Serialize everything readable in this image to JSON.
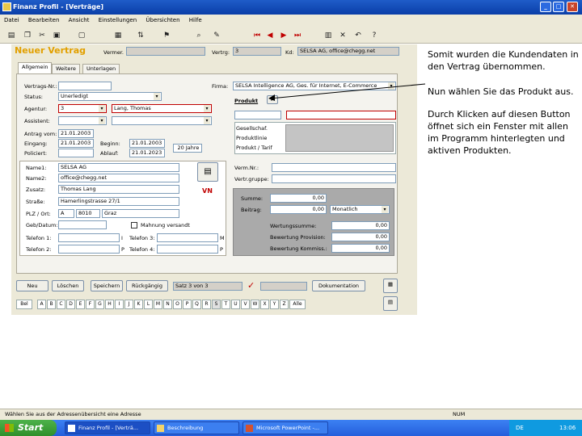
{
  "window": {
    "title": "Finanz Profil - [Verträge]",
    "controls": [
      "_",
      "□",
      "✕"
    ]
  },
  "menu": [
    "Datei",
    "Bearbeiten",
    "Ansicht",
    "Einstellungen",
    "Übersichten",
    "Hilfe"
  ],
  "toolbar_icons": [
    "printer-icon",
    "copy-icon",
    "cut-icon",
    "paste-icon",
    "document-icon",
    "grid-icon",
    "sort-icon",
    "filter-icon",
    "find-icon",
    "record-icon",
    "first-icon",
    "prev-icon",
    "next-icon",
    "last-icon",
    "help-icon"
  ],
  "form": {
    "heading": "Neuer Vertrag",
    "top": {
      "vermerk_label": "Vermer.",
      "vermerk_value": "",
      "vertrag_label": "Vertrg:",
      "vertrag_value": "3",
      "kd_label": "Kd:",
      "kd_value": "SELSA AG, office@chegg.net"
    },
    "tabs": [
      "Allgemein",
      "Weitere",
      "Unterlagen"
    ],
    "fields_left": [
      {
        "label": "Vertrags-Nr.:",
        "value": ""
      },
      {
        "label": "Status:",
        "value": "Unerledigt"
      },
      {
        "label": "Agentur:",
        "value": "3"
      },
      {
        "label": "Assistent:",
        "value": ""
      }
    ],
    "agent_name": "Lang, Thomas",
    "dates": [
      {
        "label": "Antrag vom:",
        "value": "21.01.2003"
      },
      {
        "label": "Eingang:",
        "value": "21.01.2003"
      },
      {
        "label": "Policiert:",
        "value": ""
      }
    ],
    "beginn_label": "Beginn:",
    "beginn_value": "21.01.2003",
    "ablauf_label": "Ablauf:",
    "ablauf_value": "21.01.2023",
    "laufzeit": "20 Jahre",
    "firma_label": "Firma:",
    "firma_value": "SELSA Intelligence AG, Ges. für Internet, E-Commerce",
    "produkt_label": "Produkt",
    "gray_lines": [
      "Gesellschaf.",
      "Produktlinie",
      "Produkt / Tarif"
    ],
    "customer": [
      {
        "label": "Name1:",
        "value": "SELSA AG"
      },
      {
        "label": "Name2:",
        "value": "office@chegg.net"
      },
      {
        "label": "Zusatz:",
        "value": "Thomas Lang"
      },
      {
        "label": "Straße:",
        "value": "Hamerlingstrasse 27/1"
      },
      {
        "label": "PLZ / Ort:",
        "value": "A",
        "value2": "8010",
        "value3": "Graz"
      },
      {
        "label": "Geb/Datum:",
        "value": ""
      }
    ],
    "kind_label": "VN",
    "verm_label": "Verm.Nr.:",
    "vertrgruppe_label": "Vertr.gruppe:",
    "mahnung_label": "Mahnung versandt",
    "phones": [
      {
        "label": "Telefon 1:",
        "value": "",
        "suffix": "I"
      },
      {
        "label": "Telefon 2:",
        "value": "",
        "suffix": "P"
      }
    ],
    "phones_right": [
      {
        "label": "Telefon 3:",
        "value": "",
        "suffix": "M"
      },
      {
        "label": "Telefon 4:",
        "value": "",
        "suffix": "P"
      }
    ],
    "money": [
      {
        "label": "Summe:",
        "value": "0,00"
      },
      {
        "label": "Beitrag:",
        "value": "0,00",
        "select": "Monatlich"
      }
    ],
    "bewertung": [
      {
        "label": "Wertungssumme:",
        "value": "0,00"
      },
      {
        "label": "Bewertung Provision:",
        "value": "0,00"
      },
      {
        "label": "Bewertung Kommiss.:",
        "value": "0,00"
      }
    ],
    "buttons": [
      "Neu",
      "Löschen",
      "Speichern",
      "Rückgängig"
    ],
    "satz_label": "Satz 3 von 3",
    "dokument_button": "Dokumentation",
    "alphabet": [
      "Bel",
      "A",
      "B",
      "C",
      "D",
      "E",
      "F",
      "G",
      "H",
      "I",
      "J",
      "K",
      "L",
      "M",
      "N",
      "O",
      "P",
      "Q",
      "R",
      "S",
      "T",
      "U",
      "V",
      "W",
      "X",
      "Y",
      "Z",
      "Alle"
    ]
  },
  "explanation": {
    "p1": "Somit wurden die Kundendaten in den Vertrag übernommen.",
    "p2": "Nun wählen Sie das Produkt aus.",
    "p3": "Durch Klicken auf diesen Button öffnet sich ein Fenster mit allen im Programm hinterlegten und aktiven Produkten."
  },
  "status_bar": {
    "text": "Wählen Sie aus der Adressenübersicht eine Adresse",
    "mode": "NUM"
  },
  "taskbar": {
    "start": "Start",
    "tasks": [
      "Finanz Profil - [Verträ...",
      "Beschreibung",
      "Microsoft PowerPoint -..."
    ],
    "lang": "DE",
    "clock": "13:06"
  },
  "colors": {
    "title": "#0a3ea8",
    "accent_orange": "#e2a000",
    "red": "#c00000",
    "taskbar": "#245edb",
    "start": "#2f8f2b"
  }
}
